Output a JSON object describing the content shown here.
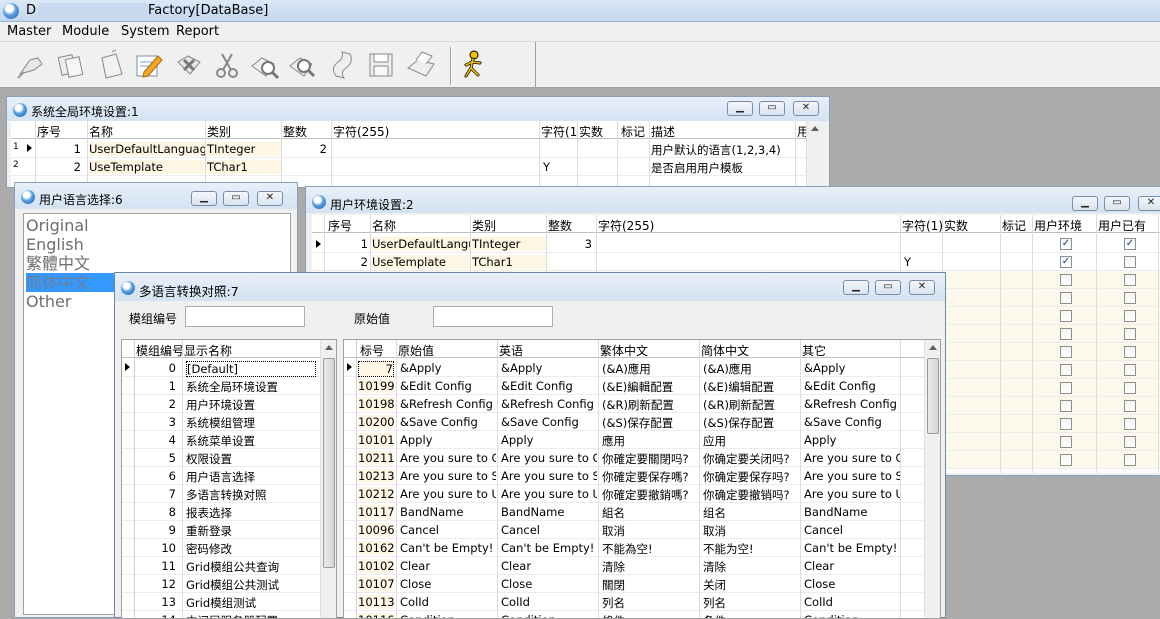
{
  "app": {
    "title": "Factory[DataBase]",
    "title_prefix": "D"
  },
  "menu": [
    "Master",
    "Module",
    "System",
    "Report"
  ],
  "toolbar": {
    "icons": [
      "broom-icon",
      "copy-icon",
      "new-document-icon",
      "edit-pencil-icon",
      "delete-icon",
      "cut-icon",
      "find-icon",
      "find-next-icon",
      "paste-icon",
      "save-icon",
      "print-icon",
      "runner-icon"
    ]
  },
  "win_global": {
    "title": "系统全局环境设置:1",
    "columns": [
      "序号",
      "名称",
      "类别",
      "整数",
      "字符(255)",
      "字符(1",
      "实数",
      "标记",
      "描述",
      "用"
    ],
    "rows": [
      {
        "idx": "1",
        "seq": "1",
        "name": "UserDefaultLanguage",
        "type": "TInteger",
        "int": "2",
        "c1": "",
        "desc": "用户默认的语言(1,2,3,4)"
      },
      {
        "idx": "2",
        "seq": "2",
        "name": "UseTemplate",
        "type": "TChar1",
        "int": "",
        "c1": "Y",
        "desc": "是否启用用户模板"
      }
    ]
  },
  "win_lang": {
    "title": "用户语言选择:6",
    "items": [
      "Original",
      "English",
      "繁體中文",
      "简体中文",
      "Other"
    ],
    "selected": 3
  },
  "win_env": {
    "title": "用户环境设置:2",
    "columns": [
      "序号",
      "名称",
      "类别",
      "整数",
      "字符(255)",
      "字符(1)",
      "实数",
      "标记",
      "用户环境",
      "用户已有"
    ],
    "rows": [
      {
        "seq": "1",
        "name": "UserDefaultLanguag",
        "type": "TInteger",
        "int": "3",
        "c1": "",
        "env": true,
        "has": true
      },
      {
        "seq": "2",
        "name": "UseTemplate",
        "type": "TChar1",
        "int": "",
        "c1": "Y",
        "env": true,
        "has": false
      }
    ],
    "extra_rows": 11
  },
  "win_ml": {
    "title": "多语言转换对照:7",
    "filter": {
      "module_label": "模组编号",
      "module_value": "",
      "orig_label": "原始值",
      "orig_value": ""
    },
    "left_columns": [
      "模组编号",
      "显示名称"
    ],
    "left_rows": [
      [
        "0",
        "[Default]"
      ],
      [
        "1",
        "系统全局环境设置"
      ],
      [
        "2",
        "用户环境设置"
      ],
      [
        "3",
        "系统模组管理"
      ],
      [
        "4",
        "系统菜单设置"
      ],
      [
        "5",
        "权限设置"
      ],
      [
        "6",
        "用户语言选择"
      ],
      [
        "7",
        "多语言转换对照"
      ],
      [
        "8",
        "报表选择"
      ],
      [
        "9",
        "重新登录"
      ],
      [
        "10",
        "密码修改"
      ],
      [
        "11",
        "Grid模组公共查询"
      ],
      [
        "12",
        "Grid模组公共测试"
      ],
      [
        "13",
        "Grid模组测试"
      ],
      [
        "14",
        "中间层服务器配置"
      ]
    ],
    "right_columns": [
      "标号",
      "原始值",
      "英语",
      "繁体中文",
      "简体中文",
      "其它"
    ],
    "right_rows": [
      [
        "7",
        "&Apply",
        "&Apply",
        "(&A)應用",
        "(&A)應用",
        "&Apply"
      ],
      [
        "10199",
        "&Edit Config",
        "&Edit Config",
        "(&E)編輯配置",
        "(&E)编辑配置",
        "&Edit Config"
      ],
      [
        "10198",
        "&Refresh Config",
        "&Refresh Config",
        "(&R)刷新配置",
        "(&R)刷新配置",
        "&Refresh Config"
      ],
      [
        "10200",
        "&Save Config",
        "&Save Config",
        "(&S)保存配置",
        "(&S)保存配置",
        "&Save Config"
      ],
      [
        "10101",
        "Apply",
        "Apply",
        "應用",
        "应用",
        "Apply"
      ],
      [
        "10211",
        "Are you sure to Clos",
        "Are you sure to Clos",
        "你確定要關閉吗?",
        "你确定要关闭吗?",
        "Are you sure to Clos"
      ],
      [
        "10213",
        "Are you sure to Save",
        "Are you sure to Save",
        "你確定要保存嗎?",
        "你确定要保存吗?",
        "Are you sure to Save"
      ],
      [
        "10212",
        "Are you sure to Und",
        "Are you sure to Und",
        "你確定要撤銷嗎?",
        "你确定要撤销吗?",
        "Are you sure to Und"
      ],
      [
        "10117",
        "BandName",
        "BandName",
        "組名",
        "组名",
        "BandName"
      ],
      [
        "10096",
        "Cancel",
        "Cancel",
        "取消",
        "取消",
        "Cancel"
      ],
      [
        "10162",
        "Can't be Empty!",
        "Can't be Empty!",
        "不能為空!",
        "不能为空!",
        "Can't be Empty!"
      ],
      [
        "10102",
        "Clear",
        "Clear",
        "清除",
        "清除",
        "Clear"
      ],
      [
        "10107",
        "Close",
        "Close",
        "關閉",
        "关闭",
        "Close"
      ],
      [
        "10113",
        "ColId",
        "ColId",
        "列名",
        "列名",
        "ColId"
      ],
      [
        "10116",
        "Condition",
        "Condition",
        "條件",
        "条件",
        "Condition"
      ]
    ]
  }
}
